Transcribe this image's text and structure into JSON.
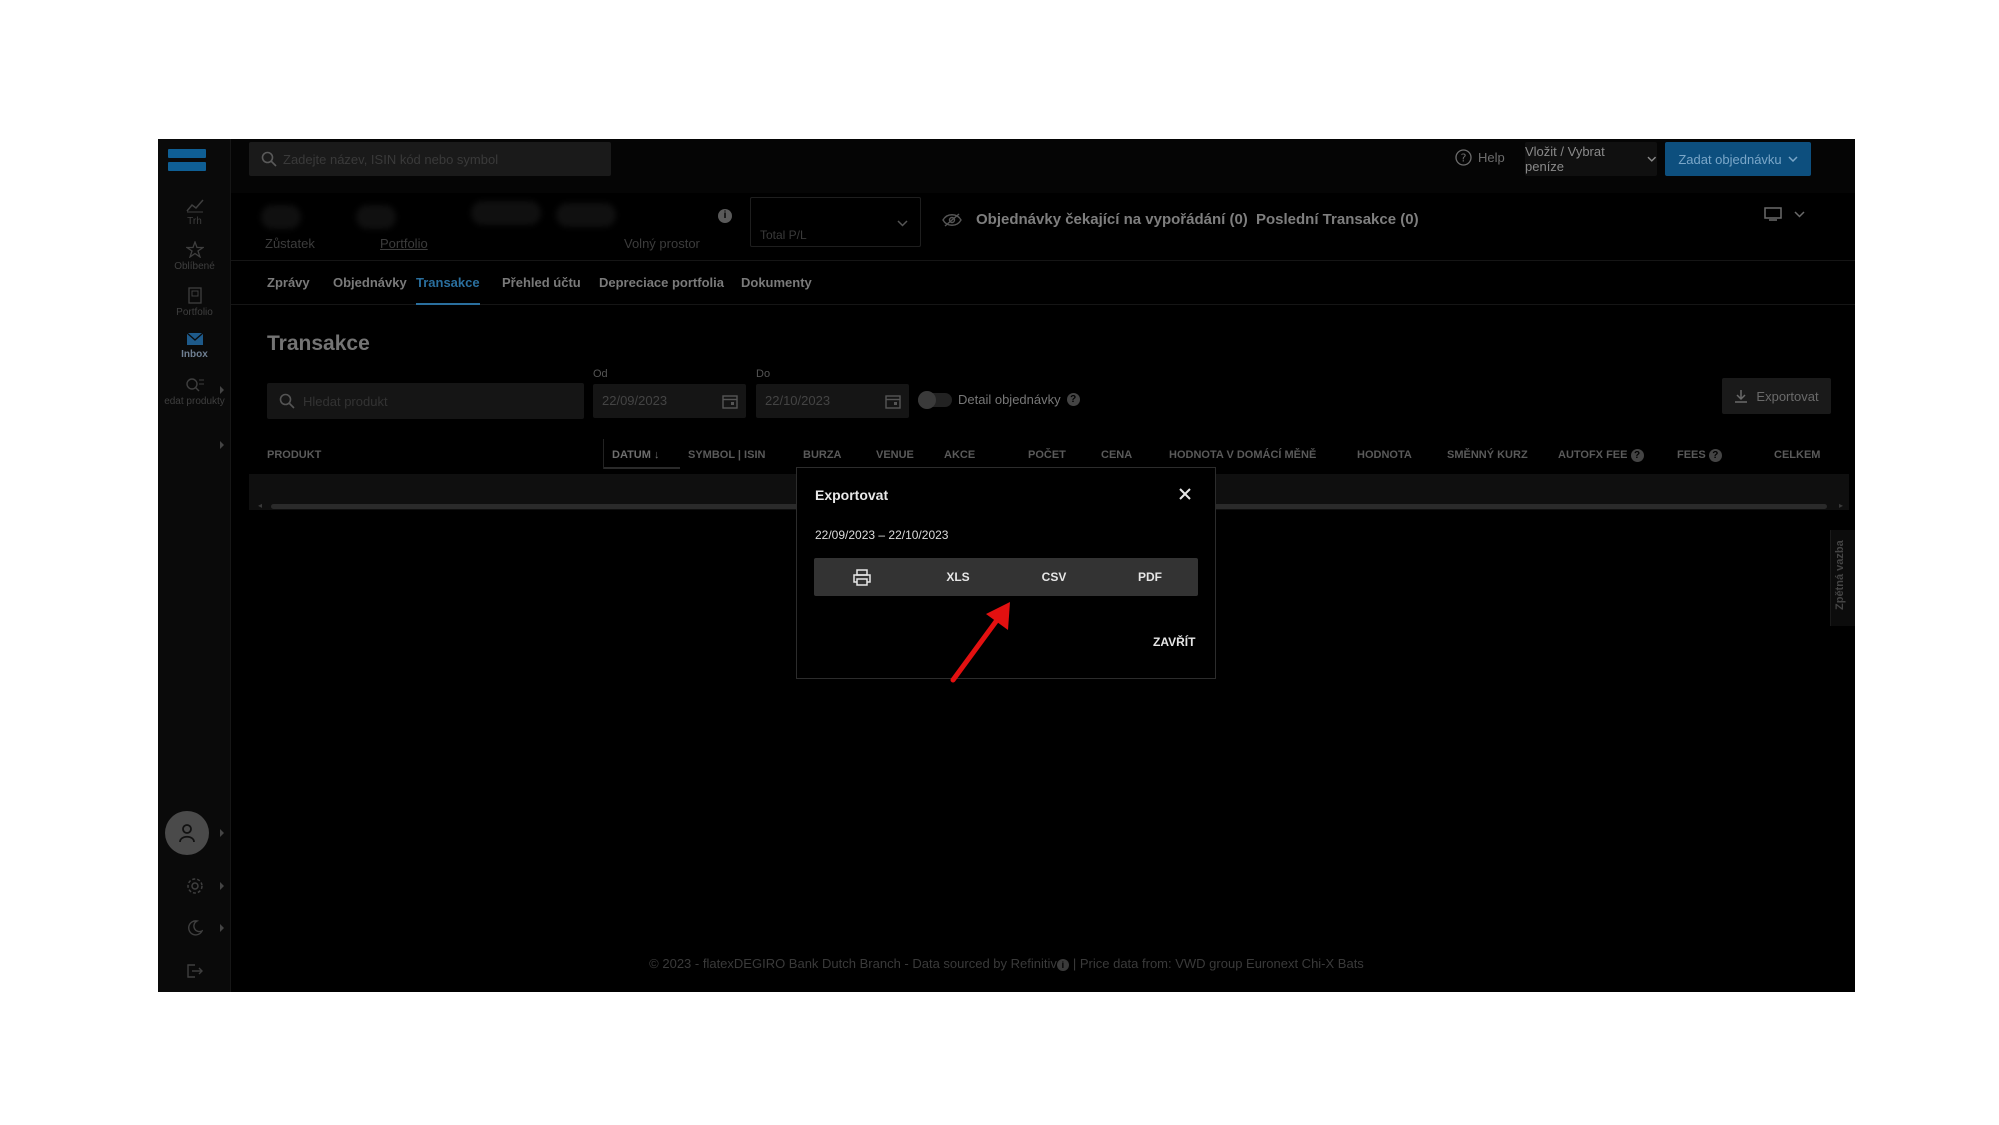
{
  "topbar": {
    "search_placeholder": "Zadejte název, ISIN kód nebo symbol",
    "help_label": "Help",
    "deposit_label": "Vložit / Vybrat peníze",
    "order_label": "Zadat objednávku"
  },
  "sidebar": {
    "items": [
      {
        "label": "Trh",
        "icon": "chart-icon"
      },
      {
        "label": "Oblíbené",
        "icon": "star-icon"
      },
      {
        "label": "Portfolio",
        "icon": "portfolio-icon"
      },
      {
        "label": "Inbox",
        "icon": "mail-icon"
      },
      {
        "label": "edat produkty",
        "icon": "search-list-icon"
      }
    ]
  },
  "summary": {
    "zustatek_label": "Zůstatek",
    "portfolio_label": "Portfolio",
    "volny_label": "Volný prostor",
    "total_pl_label": "Total P/L",
    "pending_label": "Objednávky čekající na vypořádání (0)",
    "last_tx_label": "Poslední Transakce (0)"
  },
  "tabs": [
    "Zprávy",
    "Objednávky",
    "Transakce",
    "Přehled účtu",
    "Depreciace portfolia",
    "Dokumenty"
  ],
  "active_tab": "Transakce",
  "content": {
    "title": "Transakce",
    "product_search_placeholder": "Hledat produkt",
    "from_label": "Od",
    "from_value": "22/09/2023",
    "to_label": "Do",
    "to_value": "22/10/2023",
    "detail_label": "Detail objednávky",
    "export_label": "Exportovat",
    "feedback_label": "Zpětná vazba"
  },
  "table": {
    "headers": [
      "PRODUKT",
      "DATUM",
      "SYMBOL | ISIN",
      "BURZA",
      "VENUE",
      "AKCE",
      "POČET",
      "CENA",
      "HODNOTA V DOMÁCÍ MĚNĚ",
      "HODNOTA",
      "SMĚNNÝ KURZ",
      "AUTOFX FEE",
      "FEES",
      "CELKEM"
    ]
  },
  "modal": {
    "title": "Exportovat",
    "date_range": "22/09/2023 – 22/10/2023",
    "buttons": [
      "XLS",
      "CSV",
      "PDF"
    ],
    "close_label": "ZAVŘÍT"
  },
  "footer": {
    "left": "© 2023 - flatexDEGIRO Bank Dutch Branch - Data sourced by Refinitiv",
    "right": "| Price data from: VWD group Euronext Chi-X Bats"
  },
  "colors": {
    "accent": "#2a6f9e",
    "order_button": "#0d4f7e",
    "annotation_arrow": "#e31010"
  }
}
